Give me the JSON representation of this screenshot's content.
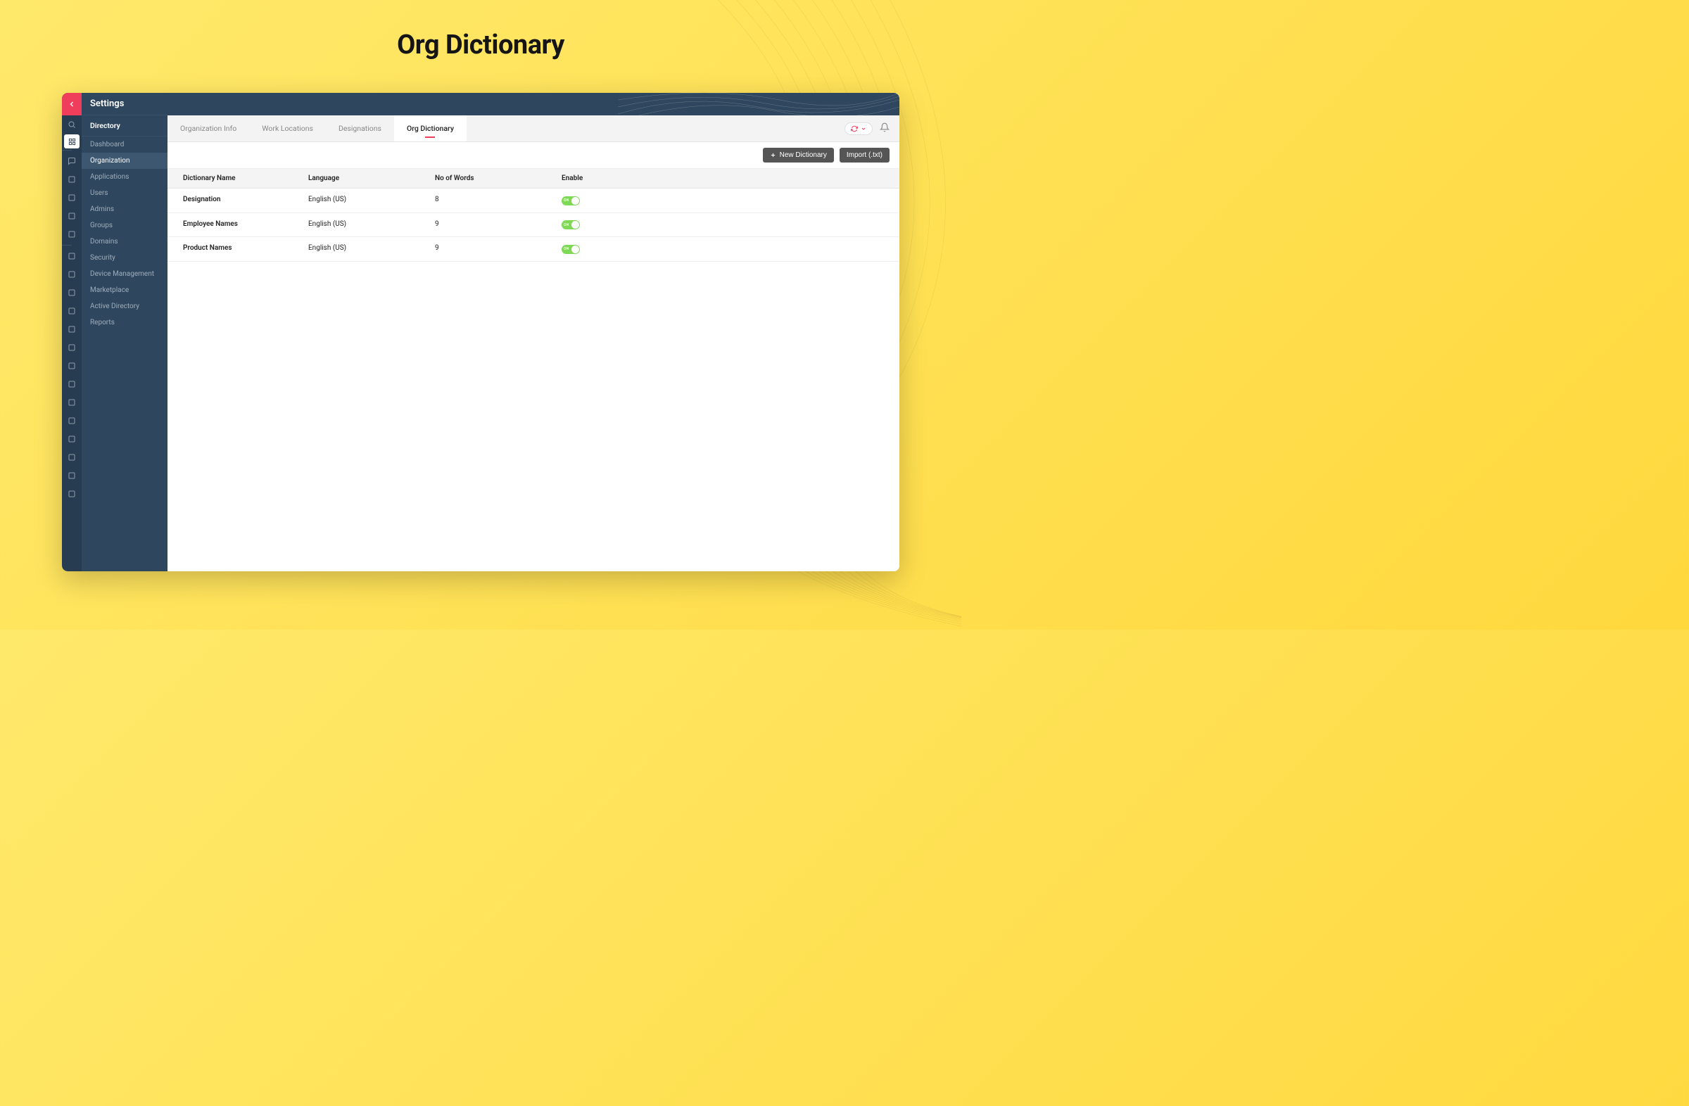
{
  "page_heading": "Org Dictionary",
  "header": {
    "title": "Settings",
    "section": "Directory"
  },
  "sidebar": {
    "items": [
      {
        "label": "Dashboard",
        "active": false
      },
      {
        "label": "Organization",
        "active": true
      },
      {
        "label": "Applications",
        "active": false
      },
      {
        "label": "Users",
        "active": false
      },
      {
        "label": "Admins",
        "active": false
      },
      {
        "label": "Groups",
        "active": false
      },
      {
        "label": "Domains",
        "active": false
      },
      {
        "label": "Security",
        "active": false
      },
      {
        "label": "Device Management",
        "active": false
      },
      {
        "label": "Marketplace",
        "active": false
      },
      {
        "label": "Active Directory",
        "active": false
      },
      {
        "label": "Reports",
        "active": false
      }
    ]
  },
  "tabs": [
    {
      "label": "Organization Info",
      "active": false
    },
    {
      "label": "Work Locations",
      "active": false
    },
    {
      "label": "Designations",
      "active": false
    },
    {
      "label": "Org Dictionary",
      "active": true
    }
  ],
  "actions": {
    "new_dictionary": "New Dictionary",
    "import": "Import (.txt)"
  },
  "table": {
    "headers": {
      "name": "Dictionary Name",
      "language": "Language",
      "words": "No of Words",
      "enable": "Enable"
    },
    "rows": [
      {
        "name": "Designation",
        "language": "English (US)",
        "words": "8",
        "enabled": true
      },
      {
        "name": "Employee Names",
        "language": "English (US)",
        "words": "9",
        "enabled": true
      },
      {
        "name": "Product Names",
        "language": "English (US)",
        "words": "9",
        "enabled": true
      }
    ]
  },
  "toggle_on_label": "ON",
  "rail_icons": [
    "search",
    "apps",
    "div",
    "chat",
    "mail",
    "stats",
    "chart",
    "users",
    "div",
    "hand",
    "shield",
    "pizza",
    "box",
    "campaign",
    "document",
    "bag",
    "puzzle",
    "tag",
    "folder",
    "screen",
    "bolt",
    "note",
    "cart"
  ]
}
